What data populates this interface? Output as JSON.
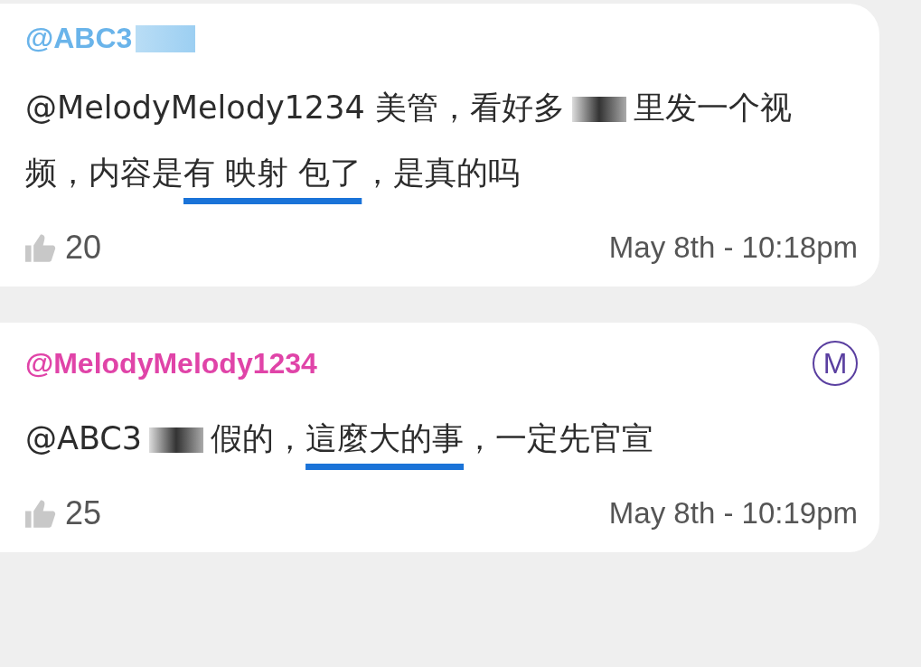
{
  "comments": [
    {
      "author": "@ABC3",
      "color": "#6ab4ea",
      "author_redacted": true,
      "body": [
        {
          "kind": "text",
          "text": "@MelodyMelody1234 美管，看好多"
        },
        {
          "kind": "redaction"
        },
        {
          "kind": "text",
          "text": "里发一个视频，内容是"
        },
        {
          "kind": "underlined",
          "text": "有 映射 包了"
        },
        {
          "kind": "text",
          "text": "，是真的吗"
        }
      ],
      "likes": "20",
      "time": "May 8th - 10:18pm"
    },
    {
      "author": "@MelodyMelody1234",
      "color": "#e044a8",
      "badge": "M",
      "body": [
        {
          "kind": "text",
          "text": "@ABC3"
        },
        {
          "kind": "redaction"
        },
        {
          "kind": "text",
          "text": "假的，"
        },
        {
          "kind": "underlined",
          "text": "這麼大的事"
        },
        {
          "kind": "text",
          "text": "，一定先官宣"
        }
      ],
      "likes": "25",
      "time": "May 8th - 10:19pm"
    }
  ]
}
